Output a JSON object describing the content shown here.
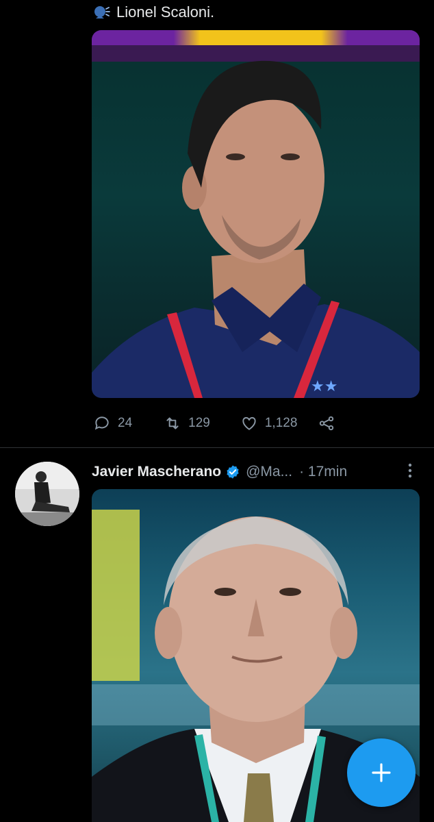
{
  "tweet1": {
    "text": "Lionel Scaloni.",
    "icon": "speaking-head-icon",
    "stats": {
      "replies": "24",
      "retweets": "129",
      "likes": "1,128"
    }
  },
  "tweet2": {
    "author_name": "Javier Mascherano",
    "handle": "@Ma...",
    "time": "· 17min",
    "verified": true
  },
  "colors": {
    "background": "#000000",
    "accent": "#1d9bf0",
    "muted_text": "#8b98a5",
    "divider": "#2f3336"
  },
  "fab": {
    "icon": "plus-icon"
  }
}
